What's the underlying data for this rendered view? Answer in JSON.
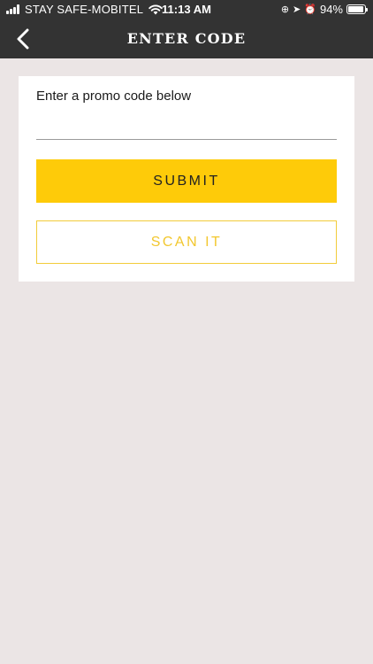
{
  "status_bar": {
    "carrier": "STAY SAFE-MOBITEL",
    "time": "11:13 AM",
    "battery_percent": "94%",
    "battery_level": 0.94
  },
  "nav": {
    "title": "ENTER CODE",
    "back_icon": "chevron-left-icon"
  },
  "promo": {
    "prompt": "Enter a promo code below",
    "input_value": "",
    "input_placeholder": "",
    "submit_label": "SUBMIT",
    "scan_label": "SCAN IT"
  },
  "colors": {
    "header_bg": "#333333",
    "page_bg": "#ebe5e5",
    "accent_yellow": "#fecb09"
  }
}
